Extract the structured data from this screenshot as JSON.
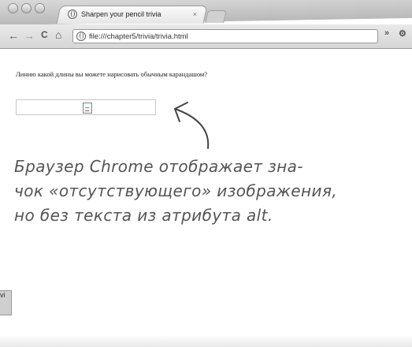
{
  "tab": {
    "title": "Sharpen your pencil trivia",
    "close": "×"
  },
  "toolbar": {
    "back": "←",
    "forward": "→",
    "reload": "C",
    "home": "⌂",
    "address": "file:///chapter5/trivia/trivia.html",
    "overflow": "»",
    "wrench": "⚙"
  },
  "page": {
    "question": "Линию какой длины вы можете нарисовать обычным карандашом?"
  },
  "annotation": {
    "lines": [
      "Браузер Chrome отображает зна-",
      "чок «отсутствующего» изображения,",
      "но без текста из атрибута alt."
    ]
  },
  "background_window": {
    "label": "vi"
  }
}
